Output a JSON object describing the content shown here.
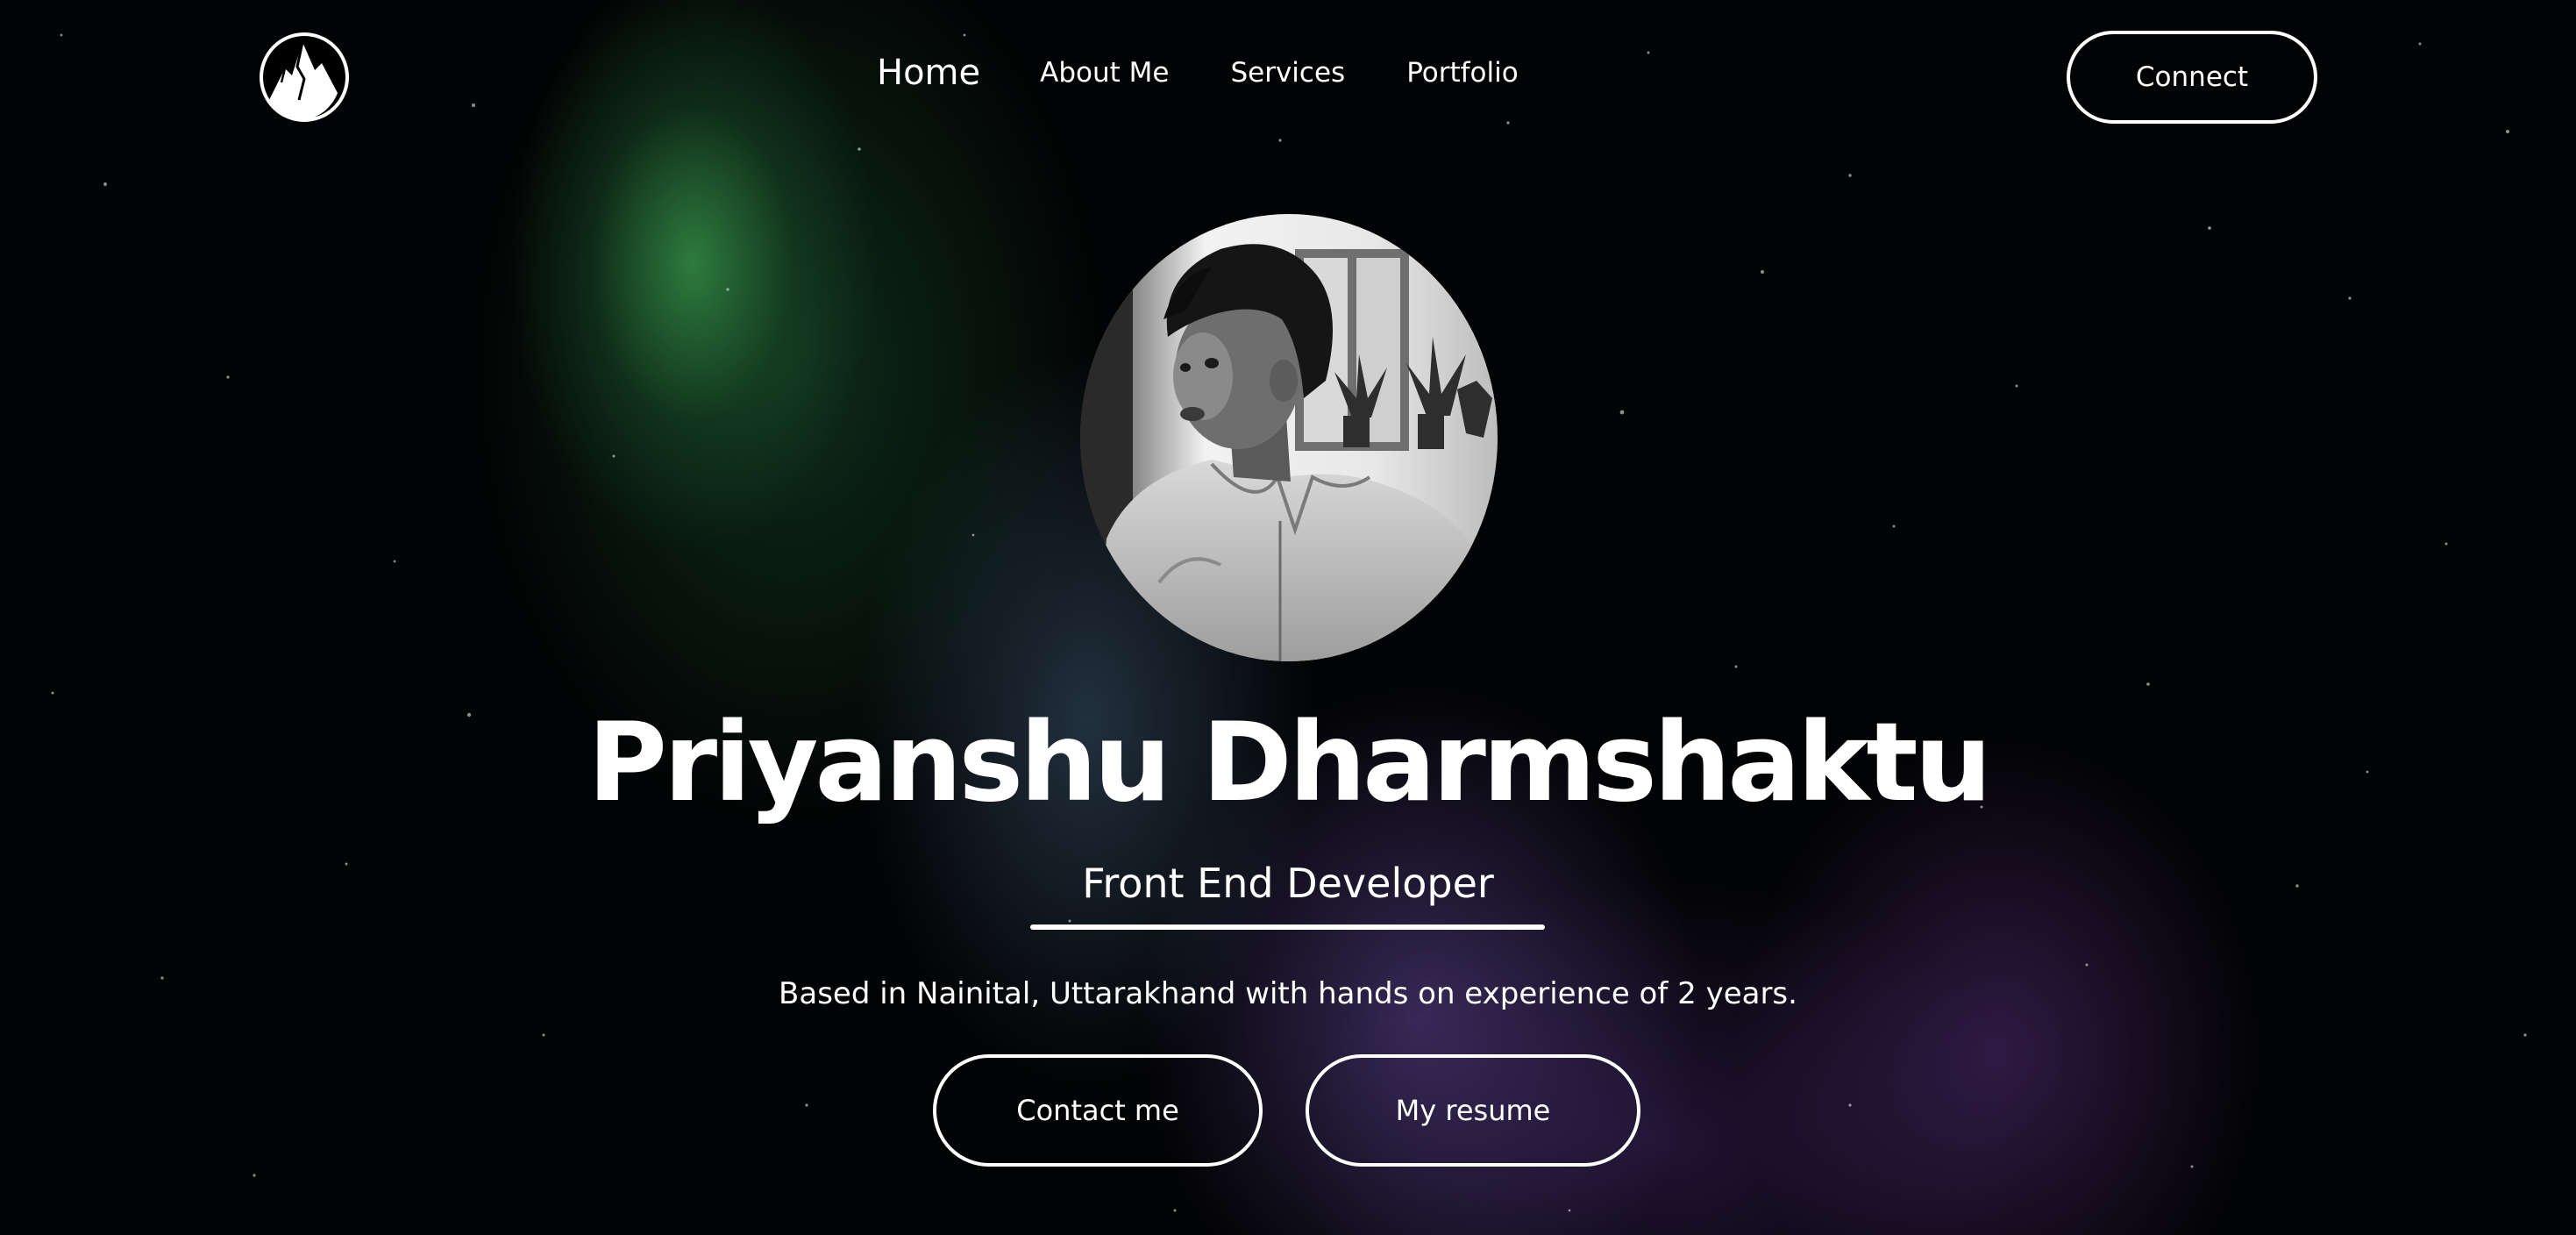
{
  "nav": {
    "logo_icon": "mountain-peak-logo-icon",
    "links": [
      "Home",
      "About Me",
      "Services",
      "Portfolio"
    ],
    "active": "Home",
    "connect_label": "Connect"
  },
  "hero": {
    "avatar_icon": "profile-photo",
    "name": "Priyanshu Dharmshaktu",
    "role": "Front End Developer",
    "bio": "Based in Nainital, Uttarakhand with hands on experience of 2 years.",
    "contact_label": "Contact me",
    "resume_label": "My resume"
  },
  "colors": {
    "background": "#020304",
    "text": "#ffffff",
    "aurora_green": "#348c46",
    "aurora_purple": "#5f4696"
  }
}
